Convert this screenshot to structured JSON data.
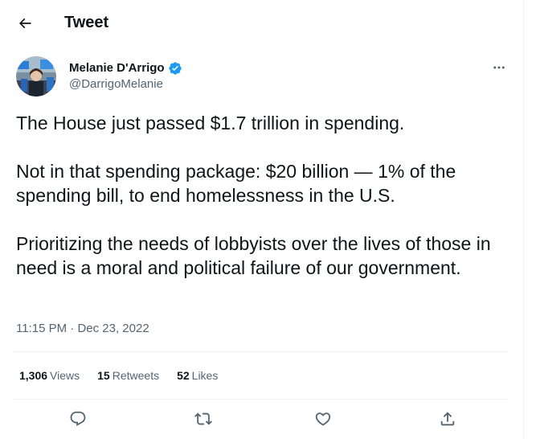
{
  "header": {
    "title": "Tweet"
  },
  "author": {
    "name": "Melanie D'Arrigo",
    "handle": "@DarrigoMelanie",
    "verified": true
  },
  "tweet": {
    "paragraphs": [
      "The House just passed $1.7 trillion in spending.",
      "Not in that spending package: $20 billion — 1% of the spending bill, to end homelessness in the U.S.",
      "Prioritizing the needs of lobbyists over the lives of those in need is a moral and political failure of our government."
    ],
    "time": "11:15 PM",
    "separator": "·",
    "date": "Dec 23, 2022"
  },
  "stats": {
    "views_count": "1,306",
    "views_label": "Views",
    "retweets_count": "15",
    "retweets_label": "Retweets",
    "likes_count": "52",
    "likes_label": "Likes"
  },
  "actions": {
    "reply_icon": "reply-icon",
    "retweet_icon": "retweet-icon",
    "like_icon": "like-icon",
    "share_icon": "share-icon"
  },
  "colors": {
    "text_primary": "#0f1419",
    "text_secondary": "#536471",
    "verified_blue": "#1d9bf0",
    "divider": "#eff3f4"
  }
}
